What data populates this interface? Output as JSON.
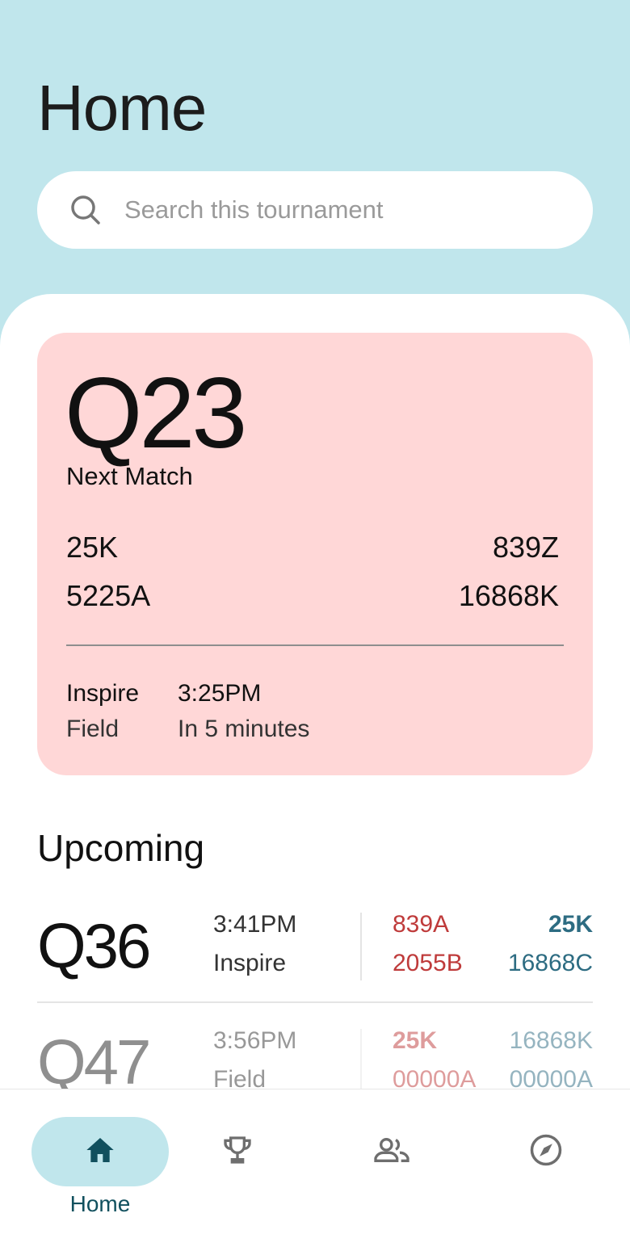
{
  "header": {
    "title": "Home"
  },
  "search": {
    "placeholder": "Search this tournament",
    "value": ""
  },
  "next_match": {
    "id": "Q23",
    "label": "Next Match",
    "red_alliance": [
      "25K",
      "5225A"
    ],
    "blue_alliance": [
      "839Z",
      "16868K"
    ],
    "field_name": "Inspire",
    "field_label": "Field",
    "time": "3:25PM",
    "relative_time": "In 5 minutes"
  },
  "upcoming": {
    "title": "Upcoming",
    "matches": [
      {
        "id": "Q36",
        "time": "3:41PM",
        "field": "Inspire",
        "red": [
          "839A",
          "2055B"
        ],
        "blue": [
          "25K",
          "16868C"
        ]
      },
      {
        "id": "Q47",
        "time": "3:56PM",
        "field": "Field",
        "red": [
          "25K",
          "00000A"
        ],
        "blue": [
          "16868K",
          "00000A"
        ]
      }
    ]
  },
  "nav": {
    "items": [
      {
        "label": "Home",
        "icon": "home-icon",
        "active": true
      },
      {
        "label": "",
        "icon": "trophy-icon",
        "active": false
      },
      {
        "label": "",
        "icon": "teams-icon",
        "active": false
      },
      {
        "label": "",
        "icon": "compass-icon",
        "active": false
      }
    ]
  },
  "colors": {
    "header_bg": "#c0e6ec",
    "card_bg": "#ffd7d7",
    "red_team": "#bf3b3b",
    "blue_team": "#2d6c82",
    "nav_active": "#11505e"
  }
}
